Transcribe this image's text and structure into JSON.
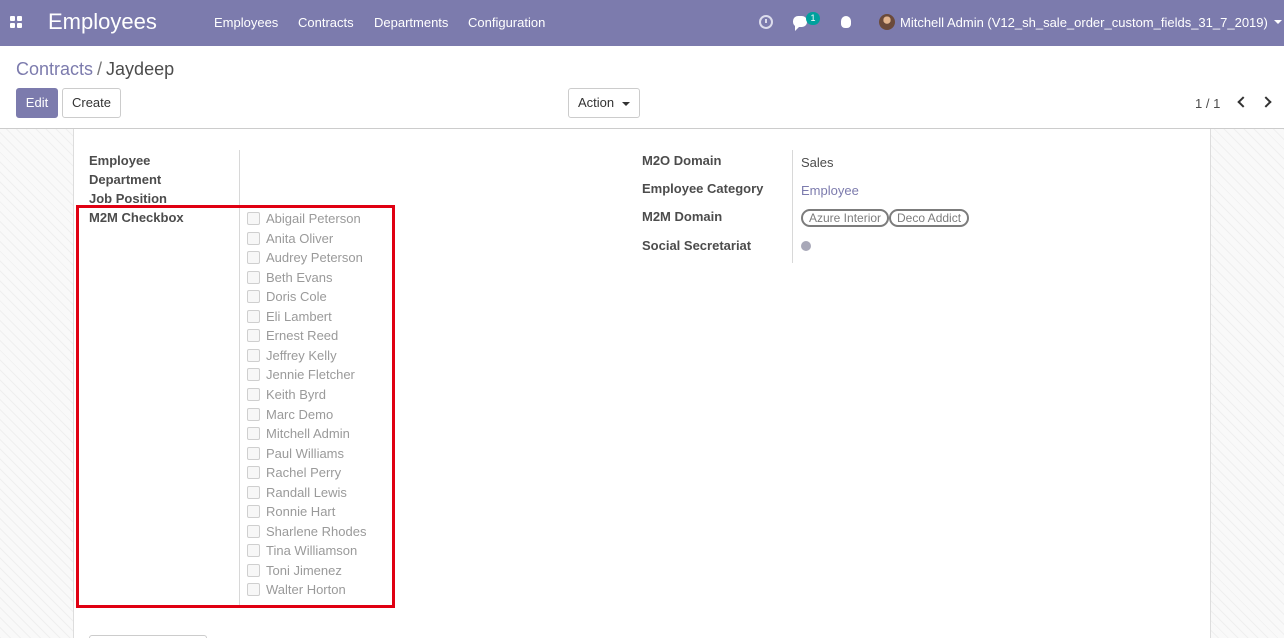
{
  "navbar": {
    "app_title": "Employees",
    "menu": [
      "Employees",
      "Contracts",
      "Departments",
      "Configuration"
    ],
    "chat_count": "1",
    "user_name": "Mitchell Admin (V12_sh_sale_order_custom_fields_31_7_2019)",
    "icons": [
      "apps-icon",
      "activity-clock-icon",
      "chat-icon",
      "bug-icon",
      "avatar"
    ]
  },
  "breadcrumb": {
    "parent": "Contracts",
    "separator": "/",
    "current": "Jaydeep"
  },
  "buttons": {
    "edit": "Edit",
    "create": "Create",
    "action": "Action"
  },
  "pager": {
    "value": "1 / 1"
  },
  "form": {
    "left_labels": [
      "Employee",
      "Department",
      "Job Position",
      "M2M Checkbox"
    ],
    "m2m_checkbox_options": [
      "Abigail Peterson",
      "Anita Oliver",
      "Audrey Peterson",
      "Beth Evans",
      "Doris Cole",
      "Eli Lambert",
      "Ernest Reed",
      "Jeffrey Kelly",
      "Jennie Fletcher",
      "Keith Byrd",
      "Marc Demo",
      "Mitchell Admin",
      "Paul Williams",
      "Rachel Perry",
      "Randall Lewis",
      "Ronnie Hart",
      "Sharlene Rhodes",
      "Tina Williamson",
      "Toni Jimenez",
      "Walter Horton"
    ],
    "right": {
      "m2o_domain_label": "M2O Domain",
      "m2o_domain_value": "Sales",
      "employee_category_label": "Employee Category",
      "employee_category_value": "Employee",
      "m2m_domain_label": "M2M Domain",
      "m2m_domain_tags": [
        "Azure Interior",
        "Deco Addict"
      ],
      "social_secretariat_label": "Social Secretariat"
    }
  },
  "colors": {
    "navbar": "#7c7bad",
    "primary": "#7c7bad",
    "highlight": "#e00012",
    "badge": "#00a09d"
  }
}
